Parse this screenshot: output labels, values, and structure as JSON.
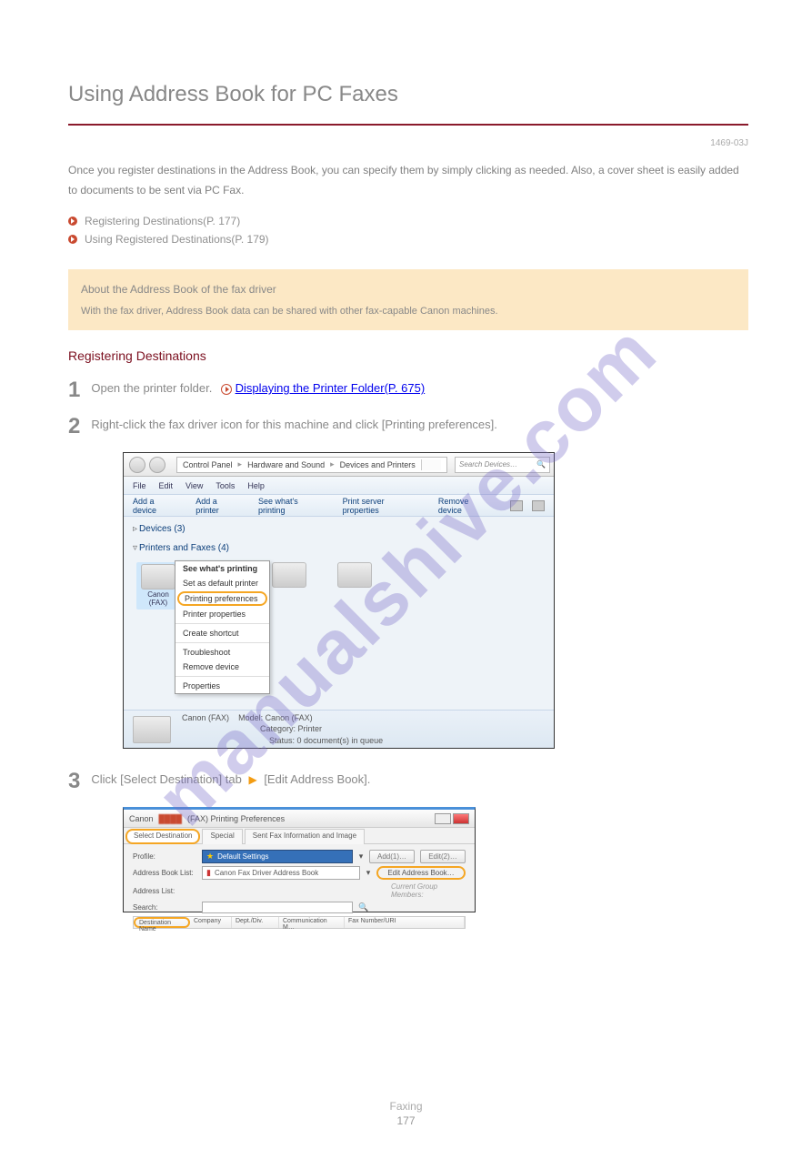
{
  "watermark": "manualshive.com",
  "title": "Using Address Book for PC Faxes",
  "revision": "1469-03J",
  "intro": "Once you register destinations in the Address Book, you can specify them by simply clicking as needed. Also, a cover sheet is easily added to documents to be sent via PC Fax.",
  "links": [
    "Registering Destinations(P. 177)",
    "Using Registered Destinations(P. 179)"
  ],
  "note": {
    "title": "About the Address Book of the fax driver",
    "body": "With the fax driver, Address Book data can be shared with other fax-capable Canon machines."
  },
  "section": "Registering Destinations",
  "steps": [
    {
      "num": "1",
      "text_pre": "Open the printer folder. ",
      "link": "Displaying the Printer Folder(P. 675)"
    },
    {
      "num": "2",
      "text": "Right-click the fax driver icon for this machine and click [Printing preferences]."
    },
    {
      "num": "3",
      "p1": "Click [Select Destination] tab",
      "p2": "[Edit Address Book]."
    }
  ],
  "ss1": {
    "crumb": [
      "Control Panel",
      "Hardware and Sound",
      "Devices and Printers"
    ],
    "search_ph": "Search Devices…",
    "menu": [
      "File",
      "Edit",
      "View",
      "Tools",
      "Help"
    ],
    "toolbar": [
      "Add a device",
      "Add a printer",
      "See what's printing",
      "Print server properties",
      "Remove device"
    ],
    "groups": {
      "devices": "Devices (3)",
      "printers": "Printers and Faxes (4)"
    },
    "printer_label": "Canon",
    "printer_fax": "(FAX)",
    "ctx": [
      "See what's printing",
      "Set as default printer",
      "Printing preferences",
      "Printer properties",
      "Create shortcut",
      "Troubleshoot",
      "Remove device",
      "Properties"
    ],
    "footer": {
      "l1": "Canon",
      "l1b": "(FAX)",
      "l2a": "Model:",
      "l2b": "Canon",
      "l2c": "(FAX)",
      "l3a": "Category:",
      "l3b": "Printer",
      "l4a": "Status:",
      "l4b": "0 document(s) in queue"
    }
  },
  "ss2": {
    "title_pre": "Canon",
    "title_post": "(FAX) Printing Preferences",
    "tabs": [
      "Select Destination",
      "Special",
      "Sent Fax Information and Image"
    ],
    "profile_label": "Profile:",
    "profile_value": "Default Settings",
    "add_btn": "Add(1)…",
    "edit_btn": "Edit(2)…",
    "abl_label": "Address Book List:",
    "abl_value": "Canon Fax Driver Address Book",
    "edit_ab_btn": "Edit Address Book…",
    "al_label": "Address List:",
    "search_label": "Search:",
    "side": "Current Group Members:",
    "cols": [
      "Destination Name",
      "Company",
      "Dept./Div.",
      "Communication M…",
      "Fax Number/URI"
    ]
  },
  "footer_cat": "Faxing",
  "page_num": "177"
}
